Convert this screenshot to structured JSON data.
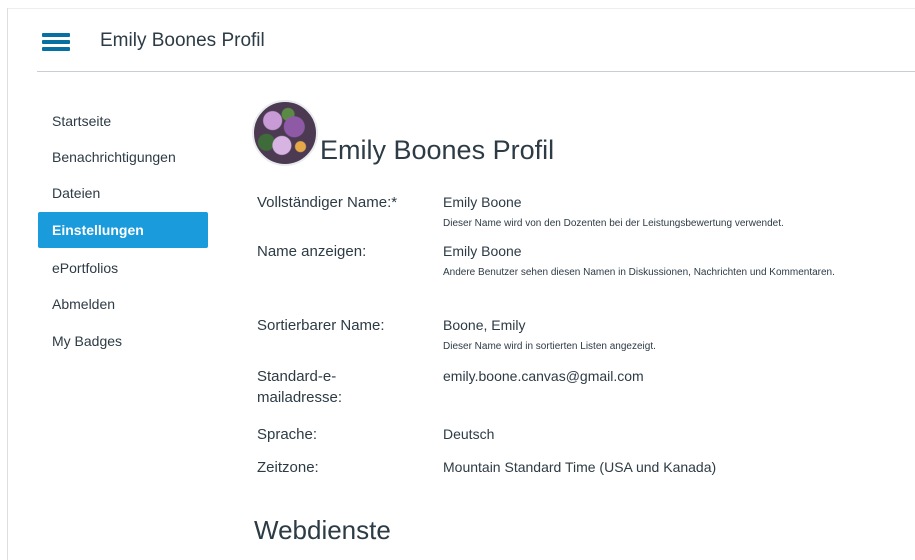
{
  "header": {
    "title": "Emily Boones Profil"
  },
  "nav": {
    "items": [
      {
        "label": "Startseite"
      },
      {
        "label": "Benachrichtigungen"
      },
      {
        "label": "Dateien"
      },
      {
        "label": "Einstellungen"
      },
      {
        "label": "ePortfolios"
      },
      {
        "label": "Abmelden"
      },
      {
        "label": "My Badges"
      }
    ],
    "active_index": 3
  },
  "profile": {
    "title": "Emily Boones Profil",
    "fields": {
      "full_name": {
        "label": "Vollständiger Name:*",
        "value": "Emily Boone",
        "hint": "Dieser Name wird von den Dozenten bei der Leistungsbewertung verwendet."
      },
      "display_name": {
        "label": "Name anzeigen:",
        "value": "Emily Boone",
        "hint": "Andere Benutzer sehen diesen Namen in Diskussionen, Nachrichten und Kommentaren."
      },
      "sortable_name": {
        "label": "Sortierbarer Name:",
        "value": "Boone, Emily",
        "hint": "Dieser Name wird in sortierten Listen angezeigt."
      },
      "email": {
        "label": "Standard-e-mailadresse:",
        "value": "emily.boone.canvas@gmail.com"
      },
      "language": {
        "label": "Sprache:",
        "value": "Deutsch"
      },
      "timezone": {
        "label": "Zeitzone:",
        "value": "Mountain Standard Time (USA und Kanada)"
      }
    }
  },
  "web_services": {
    "title": "Webdienste"
  },
  "colors": {
    "accent": "#1a9bdc",
    "hamburger": "#0770a3",
    "text": "#2d3b45"
  },
  "icons": {
    "menu": "hamburger-menu-icon"
  }
}
